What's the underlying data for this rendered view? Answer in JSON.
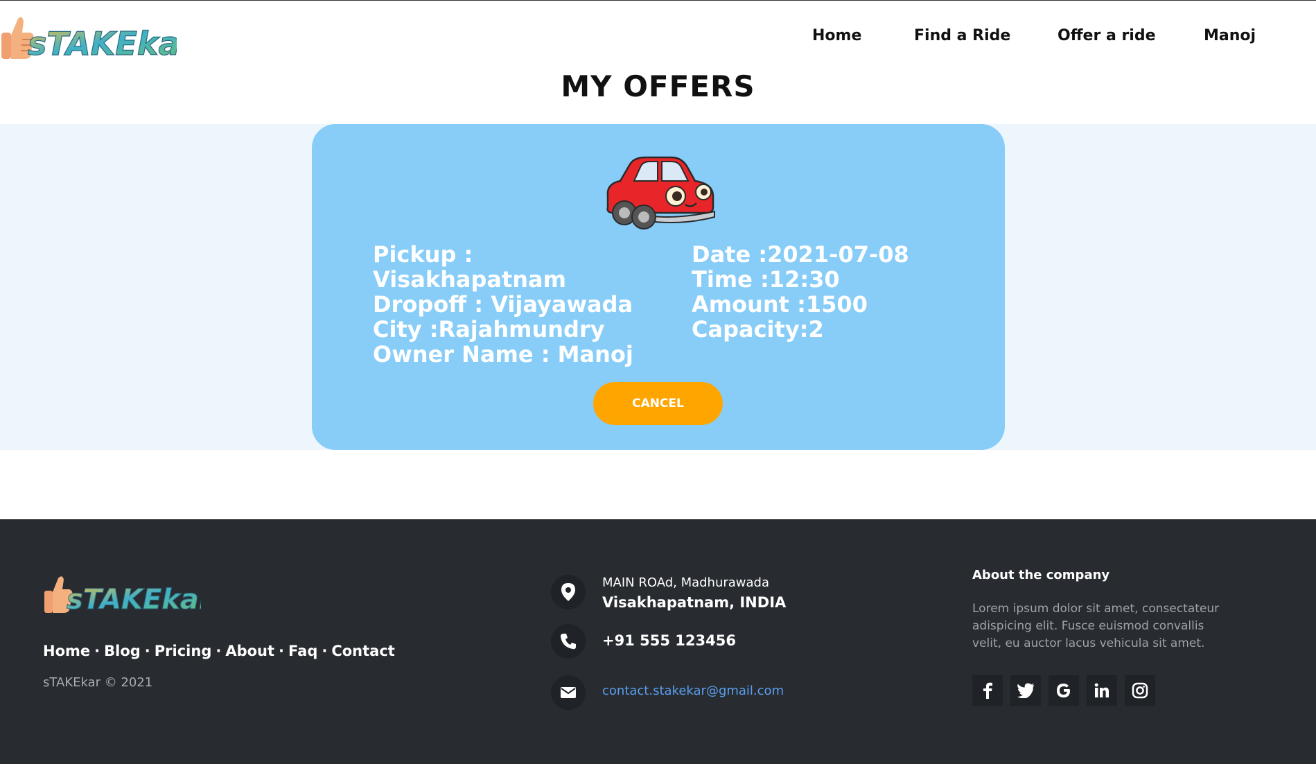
{
  "header": {
    "logo_text": "sTAKEkar",
    "nav": [
      "Home",
      "Find a Ride",
      "Offer a ride",
      "Manoj"
    ],
    "page_title": "MY OFFERS"
  },
  "offer": {
    "pickup_label": "Pickup :",
    "pickup_value": "Visakhapatnam",
    "dropoff": "Dropoff : Vijayawada",
    "city": "City :Rajahmundry",
    "owner": "Owner Name : Manoj",
    "date": "Date :2021-07-08",
    "time": "Time :12:30",
    "amount": "Amount :1500",
    "capacity": "Capacity:2",
    "cancel_label": "CANCEL"
  },
  "footer": {
    "logo_text": "sTAKEkar",
    "links": [
      "Home",
      "Blog",
      "Pricing",
      "About",
      "Faq",
      "Contact"
    ],
    "separator": "·",
    "copyright": "sTAKEkar © 2021",
    "address_line1": "MAIN ROAd, Madhurawada",
    "address_line2": "Visakhapatnam, INDIA",
    "phone": "+91 555 123456",
    "email": "contact.stakekar@gmail.com",
    "about_title": "About the company",
    "about_text": "Lorem ipsum dolor sit amet, consectateur adispicing elit. Fusce euismod convallis velit, eu auctor lacus vehicula sit amet.",
    "social_icons": [
      "facebook-icon",
      "twitter-icon",
      "google-icon",
      "linkedin-icon",
      "instagram-icon"
    ]
  },
  "colors": {
    "card_bg": "#87cdf8",
    "band_bg": "#eef6fd",
    "cancel_button": "#ffa500",
    "footer_bg": "#282c30",
    "email_link": "#5a9ef0"
  }
}
